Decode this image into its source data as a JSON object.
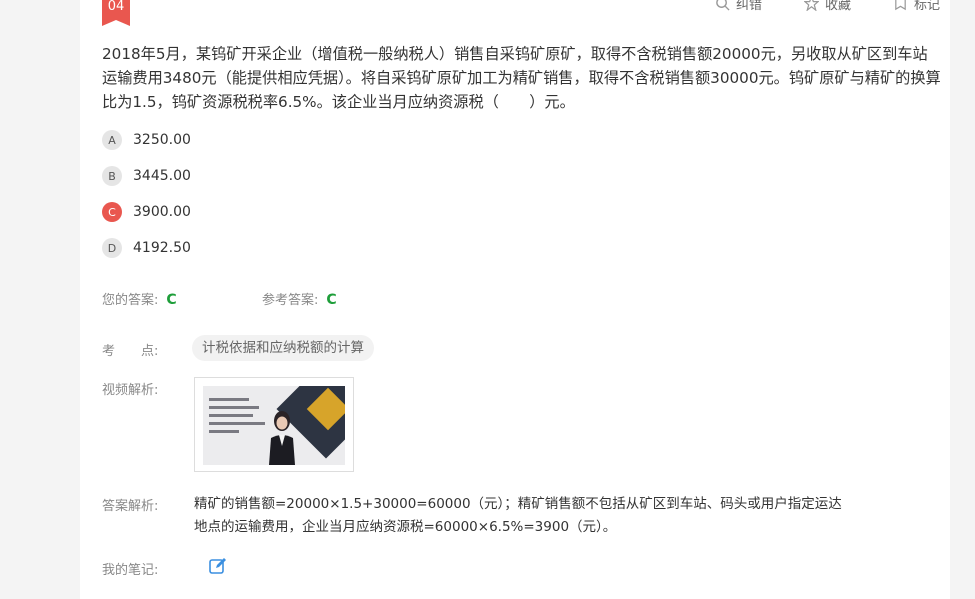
{
  "question": {
    "number": "04",
    "text": "2018年5月，某钨矿开采企业（增值税一般纳税人）销售自采钨矿原矿，取得不含税销售额20000元，另收取从矿区到车站运输费用3480元（能提供相应凭据）。将自采钨矿原矿加工为精矿销售，取得不含税销售额30000元。钨矿原矿与精矿的换算比为1.5，钨矿资源税税率6.5%。该企业当月应纳资源税（　　）元。"
  },
  "toolbar": {
    "error_label": "纠错",
    "favorite_label": "收藏",
    "mark_label": "标记"
  },
  "options": [
    {
      "letter": "A",
      "text": "3250.00"
    },
    {
      "letter": "B",
      "text": "3445.00"
    },
    {
      "letter": "C",
      "text": "3900.00",
      "selected": true
    },
    {
      "letter": "D",
      "text": "4192.50"
    }
  ],
  "answers": {
    "your_label": "您的答案:",
    "your_value": "C",
    "ref_label": "参考答案:",
    "ref_value": "C"
  },
  "knowledge": {
    "label": "考　　点:",
    "tag": "计税依据和应纳税额的计算"
  },
  "video": {
    "label": "视频解析:"
  },
  "analysis": {
    "label": "答案解析:",
    "line1": "精矿的销售额=20000×1.5+30000=60000（元）；精矿销售额不包括从矿区到车站、码头或用户指定运达",
    "line2": "地点的运输费用，企业当月应纳资源税=60000×6.5%=3900（元）。"
  },
  "notes": {
    "label": "我的笔记:"
  },
  "colors": {
    "accent": "#e9574f",
    "correct": "#1e9e3a",
    "edit_icon": "#3b8fe0"
  }
}
